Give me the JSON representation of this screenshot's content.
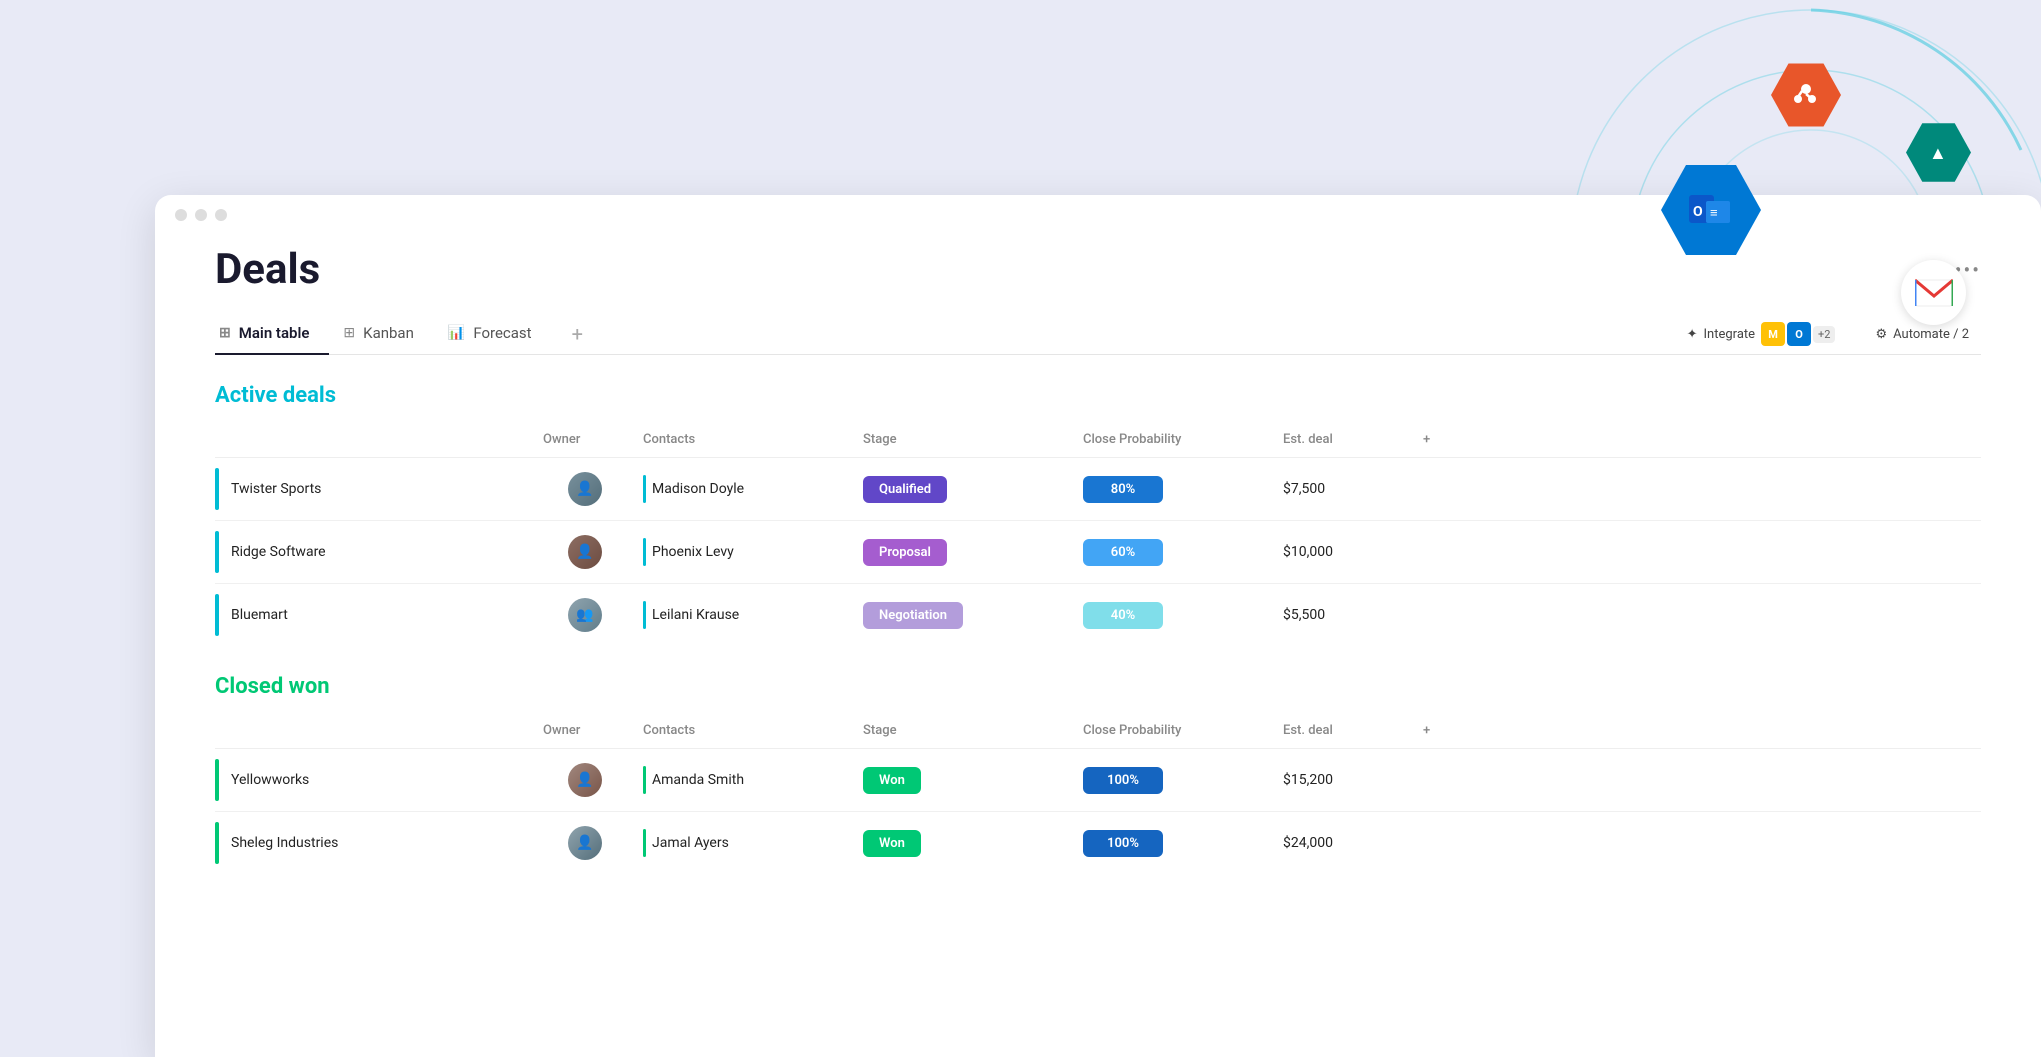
{
  "page": {
    "title": "Deals",
    "more_options_label": "•••"
  },
  "tabs": [
    {
      "id": "main-table",
      "label": "Main table",
      "active": true,
      "icon": "⊞"
    },
    {
      "id": "kanban",
      "label": "Kanban",
      "active": false,
      "icon": "⊞"
    },
    {
      "id": "forecast",
      "label": "Forecast",
      "active": false,
      "icon": "📊"
    },
    {
      "id": "add",
      "label": "+",
      "active": false
    }
  ],
  "actions": {
    "integrate": "Integrate",
    "automate": "Automate / 2"
  },
  "sections": [
    {
      "id": "active-deals",
      "title": "Active deals",
      "type": "active",
      "columns": [
        "",
        "Owner",
        "Contacts",
        "Stage",
        "Close Probability",
        "Est. deal",
        ""
      ],
      "rows": [
        {
          "company": "Twister Sports",
          "owner_avatar": "👤",
          "owner_color": "#78909c",
          "contact": "Madison Doyle",
          "stage": "Qualified",
          "stage_class": "stage-qualified",
          "probability": "80%",
          "prob_class": "prob-80",
          "deal": "$7,500"
        },
        {
          "company": "Ridge Software",
          "owner_avatar": "👤",
          "owner_color": "#8d6e63",
          "contact": "Phoenix Levy",
          "stage": "Proposal",
          "stage_class": "stage-proposal",
          "probability": "60%",
          "prob_class": "prob-60",
          "deal": "$10,000"
        },
        {
          "company": "Bluemart",
          "owner_avatar": "👥",
          "owner_color": "#9e9e9e",
          "contact": "Leilani Krause",
          "stage": "Negotiation",
          "stage_class": "stage-negotiation",
          "probability": "40%",
          "prob_class": "prob-40",
          "deal": "$5,500"
        }
      ]
    },
    {
      "id": "closed-won",
      "title": "Closed won",
      "type": "closed",
      "columns": [
        "",
        "Owner",
        "Contacts",
        "Stage",
        "Close Probability",
        "Est. deal",
        ""
      ],
      "rows": [
        {
          "company": "Yellowworks",
          "owner_avatar": "👤",
          "owner_color": "#a1887f",
          "contact": "Amanda Smith",
          "stage": "Won",
          "stage_class": "stage-won",
          "probability": "100%",
          "prob_class": "prob-100",
          "deal": "$15,200"
        },
        {
          "company": "Sheleg Industries",
          "owner_avatar": "👤",
          "owner_color": "#90a4ae",
          "contact": "Jamal Ayers",
          "stage": "Won",
          "stage_class": "stage-won",
          "probability": "100%",
          "prob_class": "prob-100",
          "deal": "$24,000"
        }
      ]
    }
  ]
}
